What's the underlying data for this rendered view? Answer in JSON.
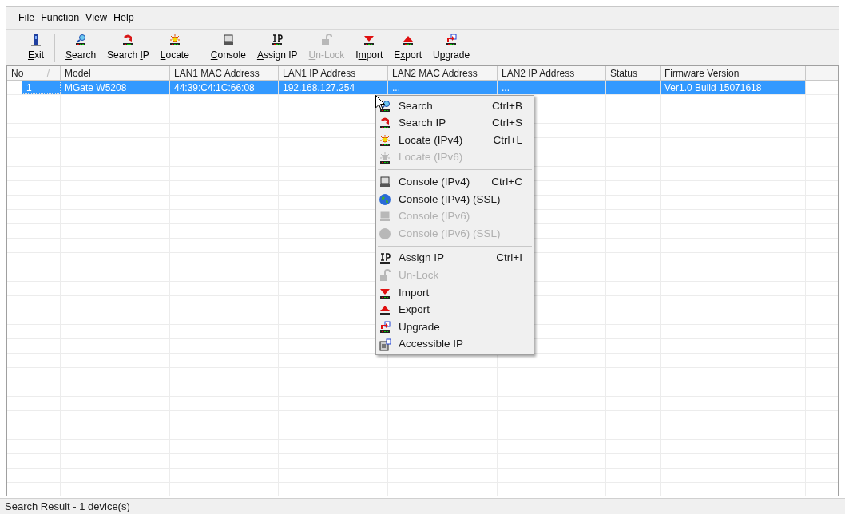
{
  "menu_bar": [
    {
      "key": "F",
      "after": "ile"
    },
    {
      "before": "Fu",
      "key": "n",
      "after": "ction"
    },
    {
      "key": "V",
      "after": "iew"
    },
    {
      "key": "H",
      "after": "elp"
    }
  ],
  "toolbar": [
    {
      "kind": "exit",
      "key": "E",
      "after": "xit",
      "disabled": false
    },
    {
      "kind": "separator"
    },
    {
      "kind": "search",
      "key": "S",
      "after": "earch",
      "disabled": false
    },
    {
      "kind": "search_ip",
      "before": "Search ",
      "key": "I",
      "after": "P",
      "disabled": false
    },
    {
      "kind": "locate",
      "key": "L",
      "after": "ocate",
      "disabled": false
    },
    {
      "kind": "separator"
    },
    {
      "kind": "console",
      "key": "C",
      "after": "onsole",
      "disabled": false
    },
    {
      "kind": "assign_ip",
      "key": "A",
      "after": "ssign IP",
      "disabled": false
    },
    {
      "kind": "unlock",
      "key": "U",
      "after": "n-Lock",
      "disabled": true
    },
    {
      "kind": "import",
      "before": "I",
      "key": "m",
      "after": "port",
      "disabled": false
    },
    {
      "kind": "export",
      "before": "E",
      "key": "x",
      "after": "port",
      "disabled": false
    },
    {
      "kind": "upgrade",
      "before": "U",
      "key": "p",
      "after": "grade",
      "disabled": false
    }
  ],
  "table": {
    "columns": [
      {
        "label": "No",
        "sort_mark": "/"
      },
      {
        "label": "Model"
      },
      {
        "label": "LAN1 MAC Address"
      },
      {
        "label": "LAN1 IP Address"
      },
      {
        "label": "LAN2 MAC Address"
      },
      {
        "label": "LAN2 IP Address"
      },
      {
        "label": "Status"
      },
      {
        "label": "Firmware Version"
      }
    ],
    "rows": [
      {
        "selected": true,
        "cells": [
          "1",
          "MGate W5208",
          "44:39:C4:1C:66:08",
          "192.168.127.254",
          "...",
          "...",
          "",
          "Ver1.0 Build 15071618"
        ]
      }
    ]
  },
  "context_menu": [
    {
      "kind": "search",
      "label": "Search",
      "shortcut": "Ctrl+B",
      "disabled": false
    },
    {
      "kind": "search_ip",
      "label": "Search IP",
      "shortcut": "Ctrl+S",
      "disabled": false
    },
    {
      "kind": "locate",
      "label": "Locate (IPv4)",
      "shortcut": "Ctrl+L",
      "disabled": false
    },
    {
      "kind": "locate",
      "label": "Locate (IPv6)",
      "disabled": true
    },
    {
      "kind": "separator"
    },
    {
      "kind": "console",
      "label": "Console (IPv4)",
      "shortcut": "Ctrl+C",
      "disabled": false
    },
    {
      "kind": "globe",
      "label": "Console (IPv4) (SSL)",
      "disabled": false
    },
    {
      "kind": "console",
      "label": "Console (IPv6)",
      "disabled": true
    },
    {
      "kind": "globe",
      "label": "Console (IPv6) (SSL)",
      "disabled": true
    },
    {
      "kind": "separator"
    },
    {
      "kind": "assign_ip",
      "label": "Assign IP",
      "shortcut": "Ctrl+I",
      "disabled": false
    },
    {
      "kind": "unlock",
      "label": "Un-Lock",
      "disabled": true
    },
    {
      "kind": "import",
      "label": "Import",
      "disabled": false
    },
    {
      "kind": "export",
      "label": "Export",
      "disabled": false
    },
    {
      "kind": "upgrade",
      "label": "Upgrade",
      "disabled": false
    },
    {
      "kind": "accessible",
      "label": "Accessible IP",
      "disabled": false
    }
  ],
  "status_bar": "Search Result - 1 device(s)"
}
